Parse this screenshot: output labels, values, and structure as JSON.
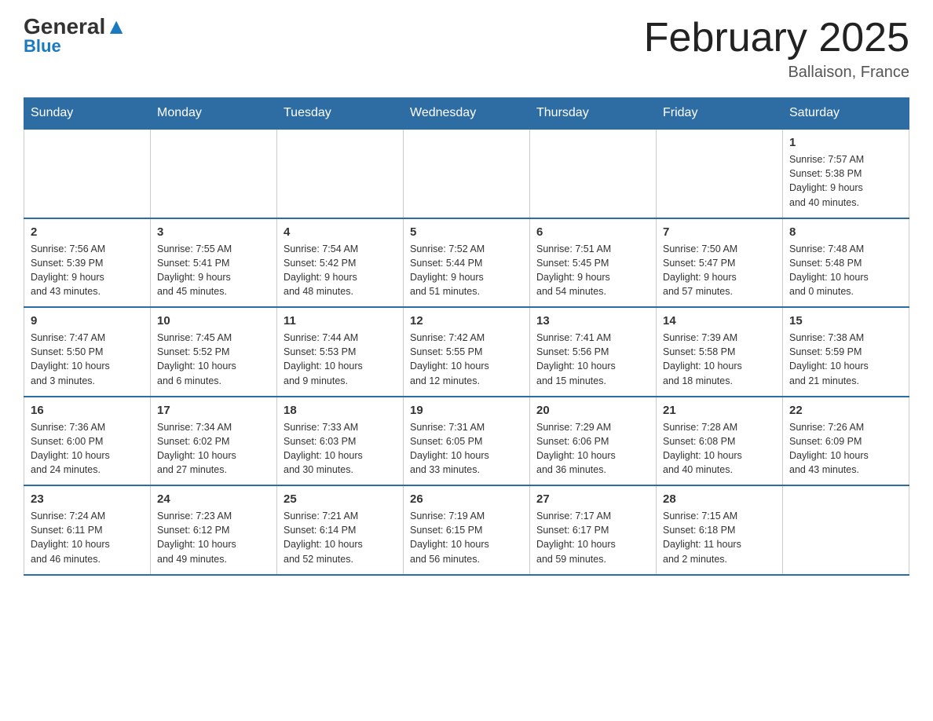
{
  "header": {
    "logo_general": "General",
    "logo_blue": "Blue",
    "month_title": "February 2025",
    "location": "Ballaison, France"
  },
  "days_of_week": [
    "Sunday",
    "Monday",
    "Tuesday",
    "Wednesday",
    "Thursday",
    "Friday",
    "Saturday"
  ],
  "weeks": [
    [
      {
        "day": "",
        "info": ""
      },
      {
        "day": "",
        "info": ""
      },
      {
        "day": "",
        "info": ""
      },
      {
        "day": "",
        "info": ""
      },
      {
        "day": "",
        "info": ""
      },
      {
        "day": "",
        "info": ""
      },
      {
        "day": "1",
        "info": "Sunrise: 7:57 AM\nSunset: 5:38 PM\nDaylight: 9 hours\nand 40 minutes."
      }
    ],
    [
      {
        "day": "2",
        "info": "Sunrise: 7:56 AM\nSunset: 5:39 PM\nDaylight: 9 hours\nand 43 minutes."
      },
      {
        "day": "3",
        "info": "Sunrise: 7:55 AM\nSunset: 5:41 PM\nDaylight: 9 hours\nand 45 minutes."
      },
      {
        "day": "4",
        "info": "Sunrise: 7:54 AM\nSunset: 5:42 PM\nDaylight: 9 hours\nand 48 minutes."
      },
      {
        "day": "5",
        "info": "Sunrise: 7:52 AM\nSunset: 5:44 PM\nDaylight: 9 hours\nand 51 minutes."
      },
      {
        "day": "6",
        "info": "Sunrise: 7:51 AM\nSunset: 5:45 PM\nDaylight: 9 hours\nand 54 minutes."
      },
      {
        "day": "7",
        "info": "Sunrise: 7:50 AM\nSunset: 5:47 PM\nDaylight: 9 hours\nand 57 minutes."
      },
      {
        "day": "8",
        "info": "Sunrise: 7:48 AM\nSunset: 5:48 PM\nDaylight: 10 hours\nand 0 minutes."
      }
    ],
    [
      {
        "day": "9",
        "info": "Sunrise: 7:47 AM\nSunset: 5:50 PM\nDaylight: 10 hours\nand 3 minutes."
      },
      {
        "day": "10",
        "info": "Sunrise: 7:45 AM\nSunset: 5:52 PM\nDaylight: 10 hours\nand 6 minutes."
      },
      {
        "day": "11",
        "info": "Sunrise: 7:44 AM\nSunset: 5:53 PM\nDaylight: 10 hours\nand 9 minutes."
      },
      {
        "day": "12",
        "info": "Sunrise: 7:42 AM\nSunset: 5:55 PM\nDaylight: 10 hours\nand 12 minutes."
      },
      {
        "day": "13",
        "info": "Sunrise: 7:41 AM\nSunset: 5:56 PM\nDaylight: 10 hours\nand 15 minutes."
      },
      {
        "day": "14",
        "info": "Sunrise: 7:39 AM\nSunset: 5:58 PM\nDaylight: 10 hours\nand 18 minutes."
      },
      {
        "day": "15",
        "info": "Sunrise: 7:38 AM\nSunset: 5:59 PM\nDaylight: 10 hours\nand 21 minutes."
      }
    ],
    [
      {
        "day": "16",
        "info": "Sunrise: 7:36 AM\nSunset: 6:00 PM\nDaylight: 10 hours\nand 24 minutes."
      },
      {
        "day": "17",
        "info": "Sunrise: 7:34 AM\nSunset: 6:02 PM\nDaylight: 10 hours\nand 27 minutes."
      },
      {
        "day": "18",
        "info": "Sunrise: 7:33 AM\nSunset: 6:03 PM\nDaylight: 10 hours\nand 30 minutes."
      },
      {
        "day": "19",
        "info": "Sunrise: 7:31 AM\nSunset: 6:05 PM\nDaylight: 10 hours\nand 33 minutes."
      },
      {
        "day": "20",
        "info": "Sunrise: 7:29 AM\nSunset: 6:06 PM\nDaylight: 10 hours\nand 36 minutes."
      },
      {
        "day": "21",
        "info": "Sunrise: 7:28 AM\nSunset: 6:08 PM\nDaylight: 10 hours\nand 40 minutes."
      },
      {
        "day": "22",
        "info": "Sunrise: 7:26 AM\nSunset: 6:09 PM\nDaylight: 10 hours\nand 43 minutes."
      }
    ],
    [
      {
        "day": "23",
        "info": "Sunrise: 7:24 AM\nSunset: 6:11 PM\nDaylight: 10 hours\nand 46 minutes."
      },
      {
        "day": "24",
        "info": "Sunrise: 7:23 AM\nSunset: 6:12 PM\nDaylight: 10 hours\nand 49 minutes."
      },
      {
        "day": "25",
        "info": "Sunrise: 7:21 AM\nSunset: 6:14 PM\nDaylight: 10 hours\nand 52 minutes."
      },
      {
        "day": "26",
        "info": "Sunrise: 7:19 AM\nSunset: 6:15 PM\nDaylight: 10 hours\nand 56 minutes."
      },
      {
        "day": "27",
        "info": "Sunrise: 7:17 AM\nSunset: 6:17 PM\nDaylight: 10 hours\nand 59 minutes."
      },
      {
        "day": "28",
        "info": "Sunrise: 7:15 AM\nSunset: 6:18 PM\nDaylight: 11 hours\nand 2 minutes."
      },
      {
        "day": "",
        "info": ""
      }
    ]
  ]
}
